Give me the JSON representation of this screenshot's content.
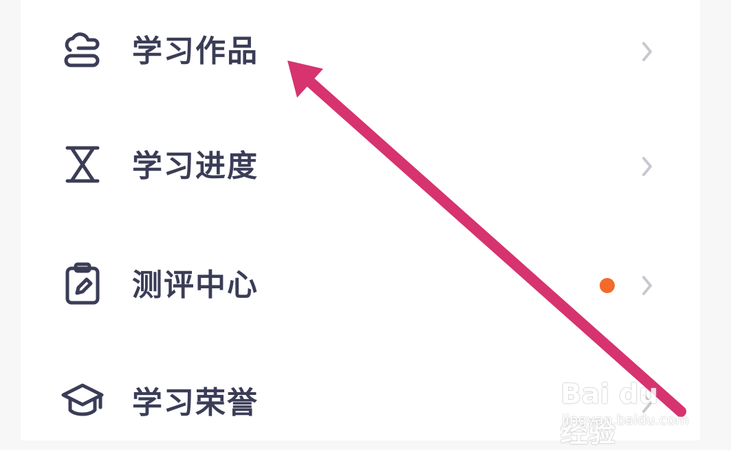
{
  "menu": {
    "items": [
      {
        "label": "学习作品",
        "icon": "cloud-stack-icon",
        "has_badge": false
      },
      {
        "label": "学习进度",
        "icon": "hourglass-icon",
        "has_badge": false
      },
      {
        "label": "测评中心",
        "icon": "clipboard-pen-icon",
        "has_badge": true
      },
      {
        "label": "学习荣誉",
        "icon": "graduation-cap-icon",
        "has_badge": false
      }
    ]
  },
  "colors": {
    "label": "#3b3d57",
    "icon": "#3b3d57",
    "chevron": "#c8c9cf",
    "badge": "#f36a2a",
    "annotation_arrow": "#d6336f"
  },
  "watermark": {
    "main": "Bai du 经验",
    "sub": "jingyan.baidu.com"
  }
}
